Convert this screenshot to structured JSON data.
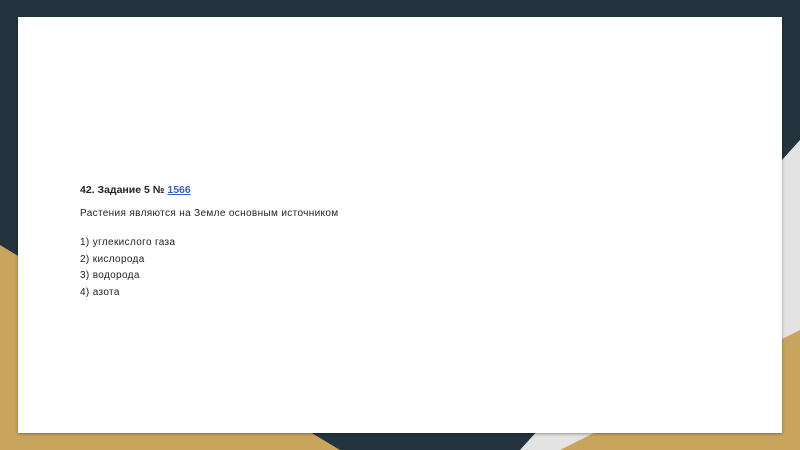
{
  "task": {
    "heading_prefix": "42. Задание 5 № ",
    "task_link": "1566",
    "question": "Растения являются на Земле основным источником",
    "options": [
      "1) углекислого газа",
      "2) кислорода",
      "3) водорода",
      "4) азота"
    ]
  },
  "colors": {
    "background_dark": "#23343f",
    "accent_gold": "#c9a45c",
    "slide_background": "#ffffff",
    "link": "#3b5fbf"
  }
}
